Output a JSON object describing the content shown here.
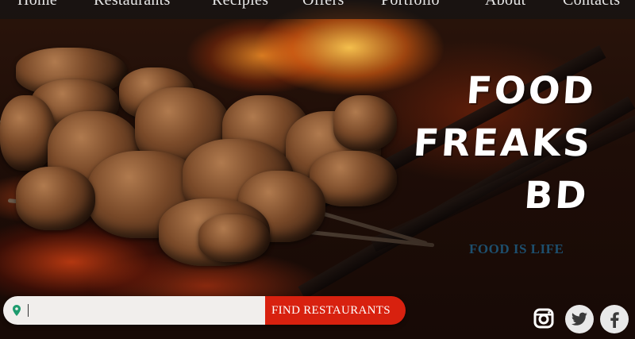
{
  "nav": {
    "items": [
      "Home",
      "Restaurants",
      "Recipies",
      "Offers",
      "Portfolio",
      "About",
      "Contacts"
    ]
  },
  "brand": {
    "lines": [
      "FOOD",
      "FREAKS",
      "BD"
    ]
  },
  "tagline": "FOOD IS LIFE",
  "search": {
    "value": "",
    "button_label": "FIND RESTAURANTS"
  },
  "social": {
    "icons": [
      "instagram-icon",
      "twitter-icon",
      "facebook-icon"
    ]
  },
  "colors": {
    "accent": "#d8210f",
    "tagline": "#1d4f6e",
    "nav_bg": "#141414"
  }
}
